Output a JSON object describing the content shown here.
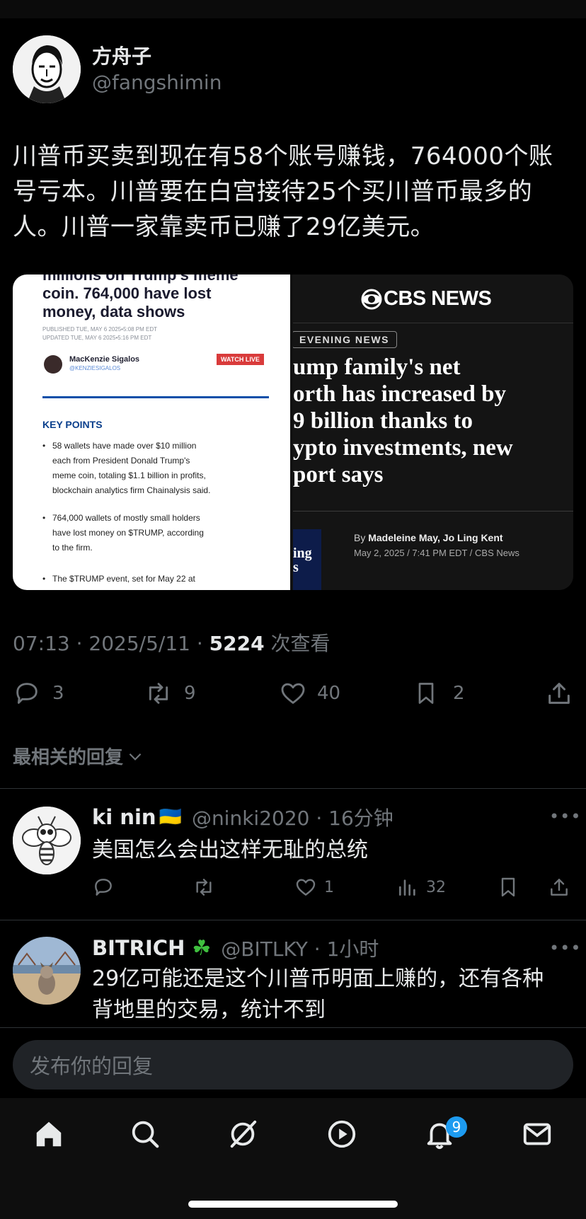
{
  "tweet": {
    "author_name": "方舟子",
    "author_handle": "@fangshimin",
    "text_lines": [
      "川普币买卖到现在有58个账号赚钱，764000个账",
      "号亏本。川普要在白宫接待25个买川普币最多的",
      "人。川普一家靠卖币已赚了29亿美元。"
    ],
    "time": "07:13 · 2025/5/11 · ",
    "views_count": "5224",
    "views_label": " 次查看",
    "replies": "3",
    "retweets": "9",
    "likes": "40",
    "bookmarks": "2"
  },
  "media_left": {
    "headline_top": "millions on Trump's meme",
    "headline_1": "coin. 764,000 have lost",
    "headline_2": "money, data shows",
    "published": "PUBLISHED TUE, MAY 6 2025•5:08 PM EDT",
    "updated": "UPDATED TUE, MAY 6 2025•5:16 PM EDT",
    "author": "MacKenzie Sigalos",
    "author_handle": "@KENZIESIGALOS",
    "watch_live": "WATCH LIVE",
    "key_points_title": "KEY POINTS",
    "points": [
      [
        "58 wallets have made over $10 million",
        "each from President Donald Trump's",
        "meme coin, totaling $1.1 billion in profits,",
        "blockchain analytics firm Chainalysis said."
      ],
      [
        "764,000 wallets of mostly small holders",
        "have lost money on $TRUMP, according",
        "to the firm."
      ],
      [
        "The $TRUMP event, set for May 22 at"
      ]
    ]
  },
  "media_right": {
    "brand": "CBS NEWS",
    "tag": "EVENING NEWS",
    "headline": [
      "ump family's net",
      "orth has increased by",
      "9 billion thanks to",
      "ypto investments, new",
      "port says"
    ],
    "byline_prefix": "By ",
    "byline_names": "Madeleine May, Jo Ling Kent",
    "dateline": "May 2, 2025 / 7:41 PM EDT / CBS News",
    "side_fragment_1": "ing",
    "side_fragment_2": "s"
  },
  "replies_sort_label": "最相关的回复",
  "replies": [
    {
      "name": "ki nin",
      "flag": "🇺🇦",
      "handle": "@ninki2020 · 16分钟",
      "text_lines": [
        "美国怎么会出这样无耻的总统"
      ],
      "likes": "1",
      "views": "32"
    },
    {
      "name": "BITRICH",
      "flag": "☘",
      "handle": "@BITLKY · 1小时",
      "text_lines": [
        "29亿可能还是这个川普币明面上赚的，还有各种",
        "背地里的交易，统计不到"
      ]
    }
  ],
  "compose_placeholder": "发布你的回复",
  "nav": {
    "notifications_badge": "9"
  },
  "colors": {
    "background": "#000000",
    "accent": "#1d9bf0",
    "muted": "#71767b",
    "cbs_red": "#c8102e"
  }
}
